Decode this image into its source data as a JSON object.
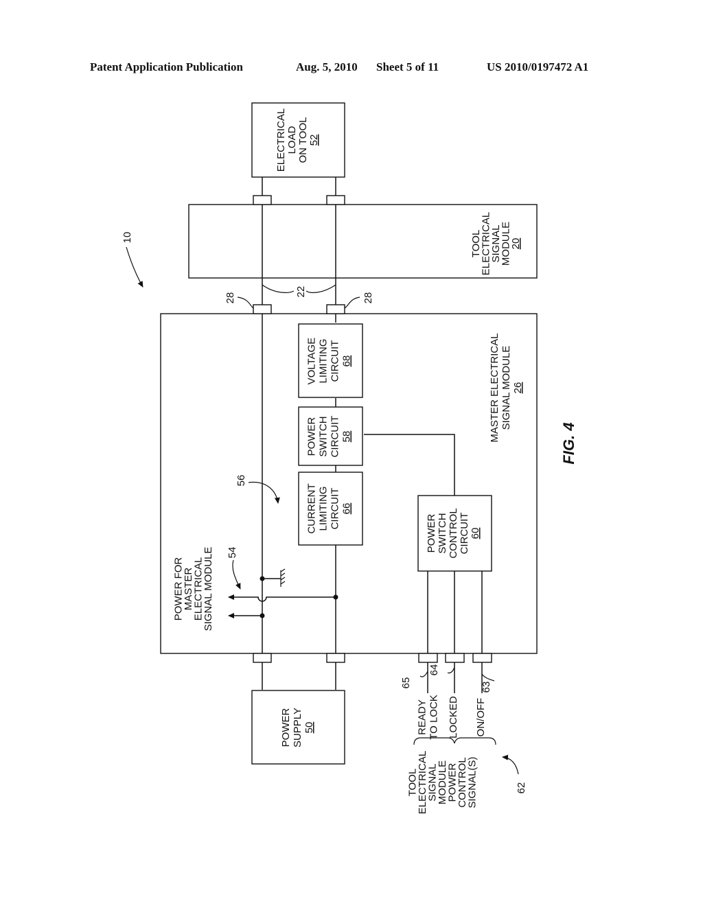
{
  "header": {
    "publication": "Patent Application Publication",
    "date": "Aug. 5, 2010",
    "sheet": "Sheet 5 of 11",
    "number": "US 2010/0197472 A1"
  },
  "figure": {
    "label": "FIG. 4",
    "system_ref": "10"
  },
  "blocks": {
    "load": {
      "lines": [
        "ELECTRICAL",
        "LOAD",
        "ON TOOL"
      ],
      "ref": "52"
    },
    "tool_module": {
      "lines": [
        "TOOL",
        "ELECTRICAL",
        "SIGNAL",
        "MODULE"
      ],
      "ref": "20"
    },
    "master_module": {
      "lines": [
        "MASTER ELECTRICAL",
        "SIGNAL MODULE"
      ],
      "ref": "26"
    },
    "voltage": {
      "lines": [
        "VOLTAGE",
        "LIMITING",
        "CIRCUIT"
      ],
      "ref": "68"
    },
    "power_switch": {
      "lines": [
        "POWER",
        "SWITCH",
        "CIRCUIT"
      ],
      "ref": "58"
    },
    "current": {
      "lines": [
        "CURRENT",
        "LIMITING",
        "CIRCUIT"
      ],
      "ref": "66"
    },
    "switch_control": {
      "lines": [
        "POWER",
        "SWITCH",
        "CONTROL",
        "CIRCUIT"
      ],
      "ref": "60"
    },
    "power_supply": {
      "lines": [
        "POWER",
        "SUPPLY"
      ],
      "ref": "50"
    }
  },
  "annotations": {
    "power_for_master": [
      "POWER FOR",
      "MASTER",
      "ELECTRICAL",
      "SIGNAL MODULE"
    ],
    "ref_54": "54",
    "ref_56": "56",
    "ref_22": "22",
    "ref_28a": "28",
    "ref_28b": "28",
    "signals": [
      {
        "lines": [
          "READY",
          "TO LOCK"
        ],
        "ref": "65"
      },
      {
        "lines": [
          "LOCKED"
        ],
        "ref": "64"
      },
      {
        "lines": [
          "ON/OFF"
        ],
        "ref": "63"
      }
    ],
    "signals_group": [
      "TOOL",
      "ELECTRICAL",
      "SIGNAL",
      "MODULE",
      "POWER",
      "CONTROL",
      "SIGNAL(S)"
    ],
    "ref_62": "62"
  }
}
